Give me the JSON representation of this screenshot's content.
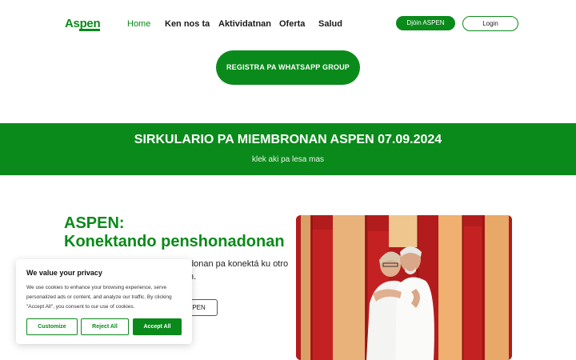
{
  "header": {
    "logo_text": "Aspen",
    "nav": [
      {
        "label": "Home",
        "active": true
      },
      {
        "label": "Ken nos ta",
        "active": false
      },
      {
        "label": "Aktividatnan",
        "active": false
      },
      {
        "label": "Oferta",
        "active": false
      },
      {
        "label": "Salud",
        "active": false
      }
    ],
    "join_label": "Djòin ASPEN",
    "login_label": "Login"
  },
  "whatsapp_button": "REGISTRA PA WHATSAPP GROUP",
  "banner": {
    "title": "SIRKULARIO PA MIEMBRONAN ASPEN 07.09.2024",
    "link": "klek aki pa lesa mas"
  },
  "hero": {
    "title_line1": "ASPEN:",
    "title_line2": "Konektando penshonadonan",
    "body_visible_1": "donan pa konektá ku otro",
    "body_visible_2": "n.",
    "button_visible": "SPEN"
  },
  "cookie": {
    "title": "We value your privacy",
    "text": "We use cookies to enhance your browsing experience, serve personalized ads or content, and analyze our traffic. By clicking \"Accept All\", you consent to our use of cookies.",
    "customize": "Customize",
    "reject": "Reject All",
    "accept": "Accept All"
  },
  "colors": {
    "brand_green": "#0a8a1a",
    "photo_red": "#b01a1a",
    "photo_gold": "#f0b070"
  },
  "icons": {
    "hero_photo": "elderly-couple-hugging-photo"
  }
}
